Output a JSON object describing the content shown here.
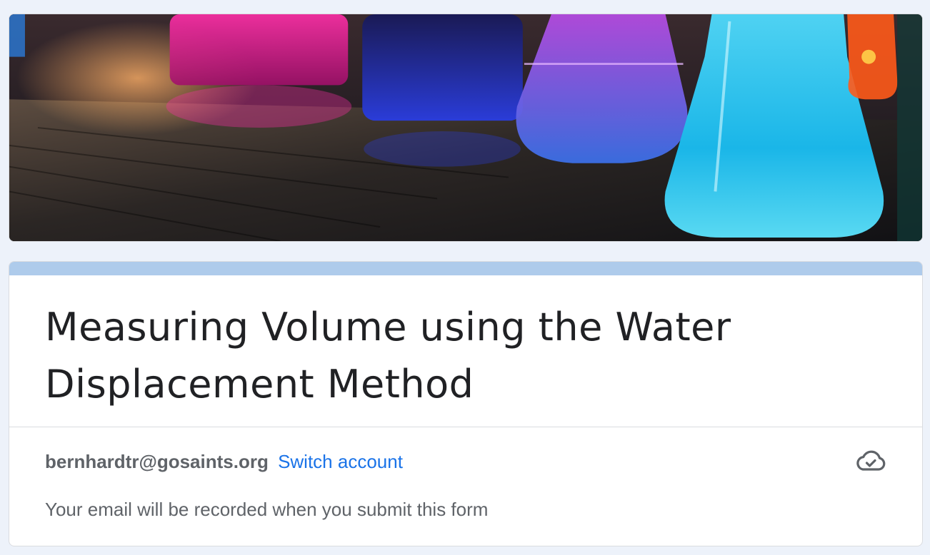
{
  "form": {
    "title": "Measuring Volume using the Water Displacement Method",
    "account_email": "bernhardtr@gosaints.org",
    "switch_account_label": "Switch account",
    "email_notice": "Your email will be recorded when you submit this form"
  },
  "icons": {
    "save_status": "cloud-done-icon"
  },
  "colors": {
    "page_background": "#edf2fa",
    "card_accent": "#aecbeb",
    "link": "#1a73e8",
    "title_text": "#202124",
    "secondary_text": "#5f6368"
  }
}
